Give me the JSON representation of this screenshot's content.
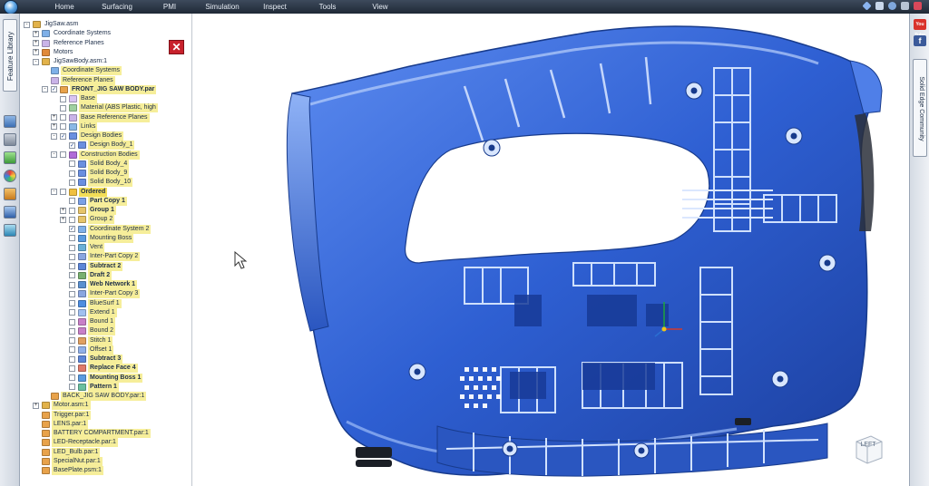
{
  "menubar": {
    "tabs": [
      "Home",
      "Surfacing",
      "PMI",
      "Simulation",
      "Inspect",
      "Tools",
      "View"
    ]
  },
  "left_rail": {
    "feature_library_label": "Feature Library"
  },
  "right_rail": {
    "community_label": "Solid Edge Community",
    "youtube_icon": "You Tube",
    "facebook_icon": "f"
  },
  "pathfinder": {
    "close_glyph": "✕",
    "tree": [
      {
        "label": "JigSaw.asm",
        "expander": "-",
        "icon": "assembly-icon"
      },
      {
        "label": "Coordinate Systems",
        "expander": "+",
        "icon": "coordinate-system-icon"
      },
      {
        "label": "Reference Planes",
        "expander": "+",
        "icon": "reference-plane-icon"
      },
      {
        "label": "Motors",
        "expander": "+",
        "icon": "motor-icon"
      },
      {
        "label": "JigSawBody.asm:1",
        "expander": "-",
        "icon": "assembly-icon"
      },
      {
        "label": "Coordinate Systems",
        "icon": "coordinate-system-icon"
      },
      {
        "label": "Reference Planes",
        "icon": "reference-plane-icon"
      },
      {
        "label": "FRONT_JIG SAW BODY.par",
        "expander": "-",
        "checked": true,
        "icon": "part-icon"
      },
      {
        "label": "Base",
        "icon": "base-icon"
      },
      {
        "label": "Material (ABS Plastic, high",
        "icon": "material-icon"
      },
      {
        "label": "Base Reference Planes",
        "expander": "+",
        "icon": "reference-plane-icon"
      },
      {
        "label": "Links",
        "expander": "+",
        "icon": "link-icon"
      },
      {
        "label": "Design Bodies",
        "expander": "-",
        "checked": true,
        "icon": "body-icon"
      },
      {
        "label": "Design Body_1",
        "checked": true,
        "icon": "body-icon"
      },
      {
        "label": "Construction Bodies",
        "expander": "-",
        "icon": "construction-body-icon"
      },
      {
        "label": "Solid Body_4",
        "icon": "body-icon"
      },
      {
        "label": "Solid Body_9",
        "icon": "body-icon"
      },
      {
        "label": "Solid Body_10",
        "icon": "body-icon"
      },
      {
        "label": "Ordered",
        "expander": "-",
        "icon": "ordered-icon"
      },
      {
        "label": "Part Copy 1",
        "icon": "part-copy-icon"
      },
      {
        "label": "Group 1",
        "expander": "+",
        "icon": "group-icon"
      },
      {
        "label": "Group 2",
        "expander": "+",
        "icon": "group-icon"
      },
      {
        "label": "Coordinate System 2",
        "checked": true,
        "icon": "coordinate-system-icon"
      },
      {
        "label": "Mounting Boss",
        "icon": "mounting-boss-icon"
      },
      {
        "label": "Vent",
        "icon": "vent-icon"
      },
      {
        "label": "Inter-Part Copy 2",
        "icon": "inter-part-copy-icon"
      },
      {
        "label": "Subtract 2",
        "icon": "subtract-icon"
      },
      {
        "label": "Draft 2",
        "icon": "draft-icon"
      },
      {
        "label": "Web Network 1",
        "icon": "web-network-icon"
      },
      {
        "label": "Inter-Part Copy 3",
        "icon": "inter-part-copy-icon"
      },
      {
        "label": "BlueSurf 1",
        "icon": "bluesurf-icon"
      },
      {
        "label": "Extend 1",
        "icon": "extend-icon"
      },
      {
        "label": "Bound 1",
        "icon": "bound-icon"
      },
      {
        "label": "Bound 2",
        "icon": "bound-icon"
      },
      {
        "label": "Stitch 1",
        "icon": "stitch-icon"
      },
      {
        "label": "Offset 1",
        "icon": "offset-icon"
      },
      {
        "label": "Subtract 3",
        "icon": "subtract-icon"
      },
      {
        "label": "Replace Face 4",
        "icon": "replace-face-icon"
      },
      {
        "label": "Mounting Boss 1",
        "icon": "mounting-boss-icon"
      },
      {
        "label": "Pattern 1",
        "icon": "pattern-icon"
      },
      {
        "label": "BACK_JIG SAW BODY.par:1",
        "icon": "part-icon"
      },
      {
        "label": "Motor.asm:1",
        "expander": "+",
        "icon": "assembly-icon"
      },
      {
        "label": "Trigger.par:1",
        "icon": "part-icon"
      },
      {
        "label": "LENS.par:1",
        "icon": "part-icon"
      },
      {
        "label": "BATTERY COMPARTMENT.par:1",
        "icon": "part-icon"
      },
      {
        "label": "LED-Receptacle.par:1",
        "icon": "part-icon"
      },
      {
        "label": "LED_Bulb.par:1",
        "icon": "part-icon"
      },
      {
        "label": "SpecialNut.par:1",
        "icon": "part-icon"
      },
      {
        "label": "BasePlate.psm:1",
        "icon": "part-icon"
      }
    ]
  },
  "graphics": {
    "view_cube_label": "LEFT",
    "model_color": "#2f63d8"
  }
}
